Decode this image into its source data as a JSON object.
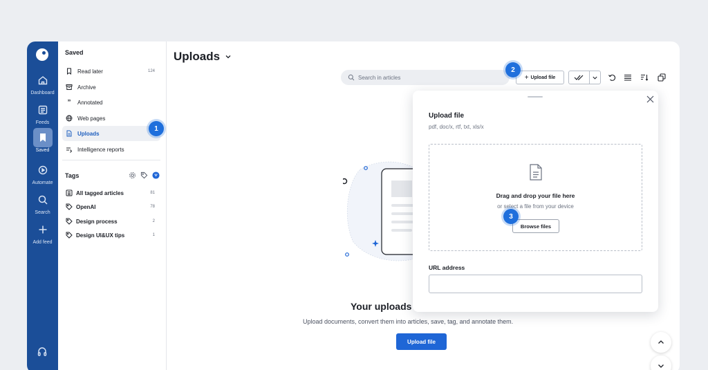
{
  "rail": {
    "items": [
      {
        "label": "Dashboard",
        "icon": "home-icon"
      },
      {
        "label": "Feeds",
        "icon": "feeds-icon"
      },
      {
        "label": "Saved",
        "icon": "bookmark-icon",
        "active": true
      },
      {
        "label": "Automate",
        "icon": "automate-icon"
      },
      {
        "label": "Search",
        "icon": "search-icon"
      },
      {
        "label": "Add feed",
        "icon": "plus-icon"
      }
    ]
  },
  "sidebar": {
    "heading": "Saved",
    "items": [
      {
        "label": "Read later",
        "count": "124",
        "icon": "bookmark-icon"
      },
      {
        "label": "Archive",
        "count": "",
        "icon": "archive-icon"
      },
      {
        "label": "Annotated",
        "count": "",
        "icon": "quote-icon"
      },
      {
        "label": "Web pages",
        "count": "",
        "icon": "globe-icon"
      },
      {
        "label": "Uploads",
        "count": "",
        "icon": "document-icon",
        "active": true
      },
      {
        "label": "Intelligence reports",
        "count": "",
        "icon": "report-icon"
      }
    ],
    "tags_heading": "Tags",
    "tags": [
      {
        "label": "All tagged articles",
        "count": "81",
        "icon": "list-icon"
      },
      {
        "label": "OpenAI",
        "count": "78",
        "icon": "tag-icon"
      },
      {
        "label": "Design process",
        "count": "2",
        "icon": "tag-icon"
      },
      {
        "label": "Design UI&UX tips",
        "count": "1",
        "icon": "tag-icon"
      }
    ]
  },
  "main": {
    "title": "Uploads",
    "search_placeholder": "Search in articles",
    "upload_button": "Upload file",
    "empty_title": "Your uploads",
    "empty_description": "Upload documents, convert them into articles, save, tag, and annotate them.",
    "empty_button": "Upload file"
  },
  "panel": {
    "title": "Upload file",
    "subtitle": "pdf, doc/x, rtf, txt, xls/x",
    "drop_title": "Drag and drop your file here",
    "drop_subtitle": "or select a file from your device",
    "browse_button": "Browse files",
    "url_label": "URL address"
  },
  "badges": [
    "1",
    "2",
    "3"
  ],
  "colors": {
    "rail": "#1b4e98",
    "accent": "#1f66d6",
    "badge": "#1f6fdc"
  }
}
